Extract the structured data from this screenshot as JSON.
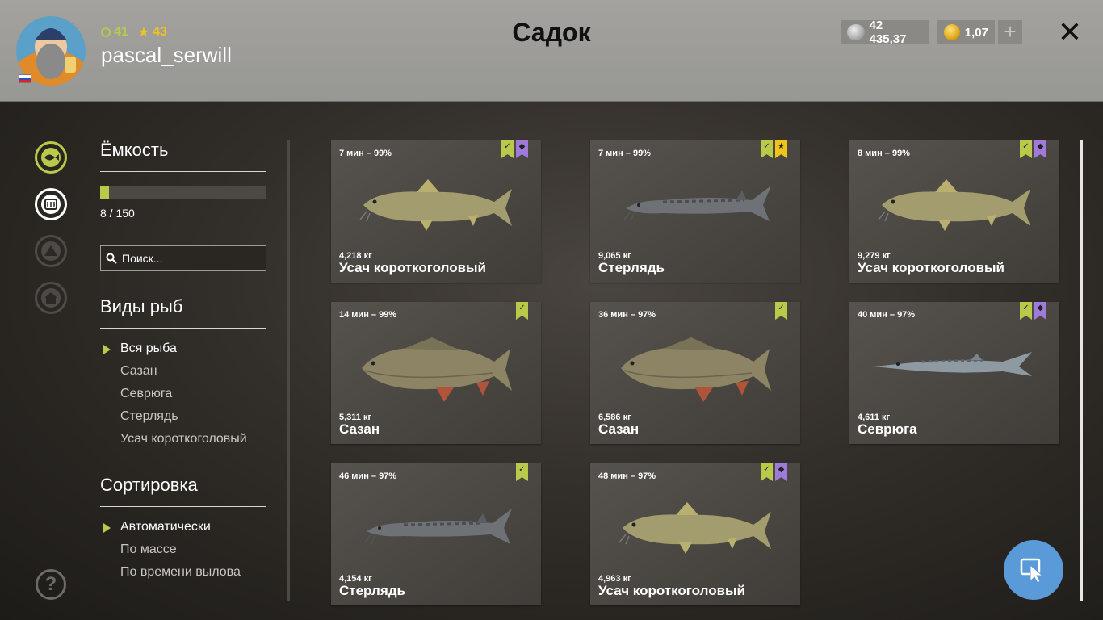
{
  "header": {
    "title": "Садок",
    "username": "pascal_serwill",
    "rank_level": "41",
    "star_level": "43",
    "silver_amount": "42 435,37",
    "gold_amount": "1,07",
    "plus_label": "+",
    "close_label": "✕"
  },
  "rail": {
    "icons": [
      "fish-icon",
      "keepnet-icon",
      "tent-icon",
      "home-icon"
    ],
    "help_label": "?"
  },
  "capacity": {
    "heading": "Ёмкость",
    "text": "8 / 150",
    "used": 8,
    "total": 150
  },
  "search": {
    "placeholder": "Поиск..."
  },
  "species": {
    "heading": "Виды рыб",
    "items": [
      "Вся рыба",
      "Сазан",
      "Севрюга",
      "Стерлядь",
      "Усач короткоголовый"
    ],
    "selected": "Вся рыба"
  },
  "sorting": {
    "heading": "Сортировка",
    "items": [
      "Автоматически",
      "По массе",
      "По времени вылова"
    ],
    "selected": "Автоматически"
  },
  "fish": [
    {
      "meta": "7 мин – 99%",
      "weight": "4,218 кг",
      "name": "Усач короткоголовый",
      "kind": "barbel",
      "badges": [
        "check",
        "purple"
      ]
    },
    {
      "meta": "7 мин – 99%",
      "weight": "9,065 кг",
      "name": "Стерлядь",
      "kind": "sterlet",
      "badges": [
        "check",
        "star"
      ]
    },
    {
      "meta": "8 мин – 99%",
      "weight": "9,279 кг",
      "name": "Усач короткоголовый",
      "kind": "barbel",
      "badges": [
        "check",
        "purple"
      ]
    },
    {
      "meta": "14 мин – 99%",
      "weight": "5,311 кг",
      "name": "Сазан",
      "kind": "carp",
      "badges": [
        "check"
      ]
    },
    {
      "meta": "36 мин – 97%",
      "weight": "6,586 кг",
      "name": "Сазан",
      "kind": "carp",
      "badges": [
        "check"
      ]
    },
    {
      "meta": "40 мин – 97%",
      "weight": "4,611 кг",
      "name": "Севрюга",
      "kind": "sevruga",
      "badges": [
        "check",
        "purple"
      ]
    },
    {
      "meta": "46 мин – 97%",
      "weight": "4,154 кг",
      "name": "Стерлядь",
      "kind": "sterlet",
      "badges": [
        "check"
      ]
    },
    {
      "meta": "48 мин – 97%",
      "weight": "4,963 кг",
      "name": "Усач короткоголовый",
      "kind": "barbel",
      "badges": [
        "check",
        "purple"
      ]
    }
  ],
  "colors": {
    "accent": "#b9c94a",
    "star": "#f0c419",
    "purple": "#a07ad8",
    "fab": "#5b9ad8"
  }
}
